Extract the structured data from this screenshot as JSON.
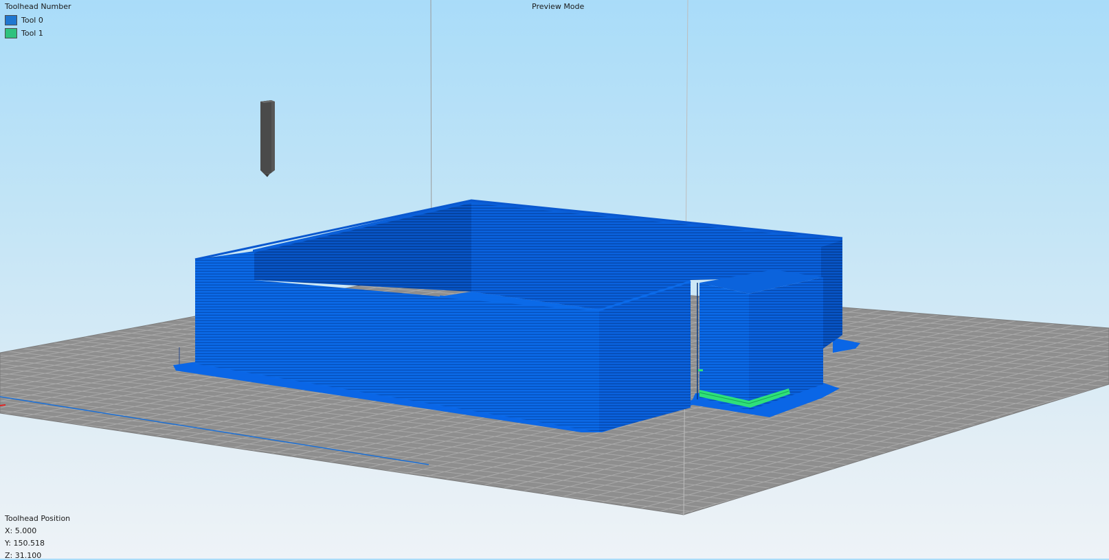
{
  "legend": {
    "title": "Toolhead Number",
    "tools": [
      {
        "label": "Tool 0",
        "color": "#1f77d0"
      },
      {
        "label": "Tool 1",
        "color": "#2ec27e"
      }
    ]
  },
  "mode_label": "Preview Mode",
  "position": {
    "title": "Toolhead Position",
    "x": "X: 5.000",
    "y": "Y: 150.518",
    "z": "Z: 31.100"
  },
  "colors": {
    "model_blue": "#0a63e0",
    "tool1_green": "#25d36a",
    "bed_grey": "#8f8f8f",
    "toolhead_grey": "#555555"
  }
}
